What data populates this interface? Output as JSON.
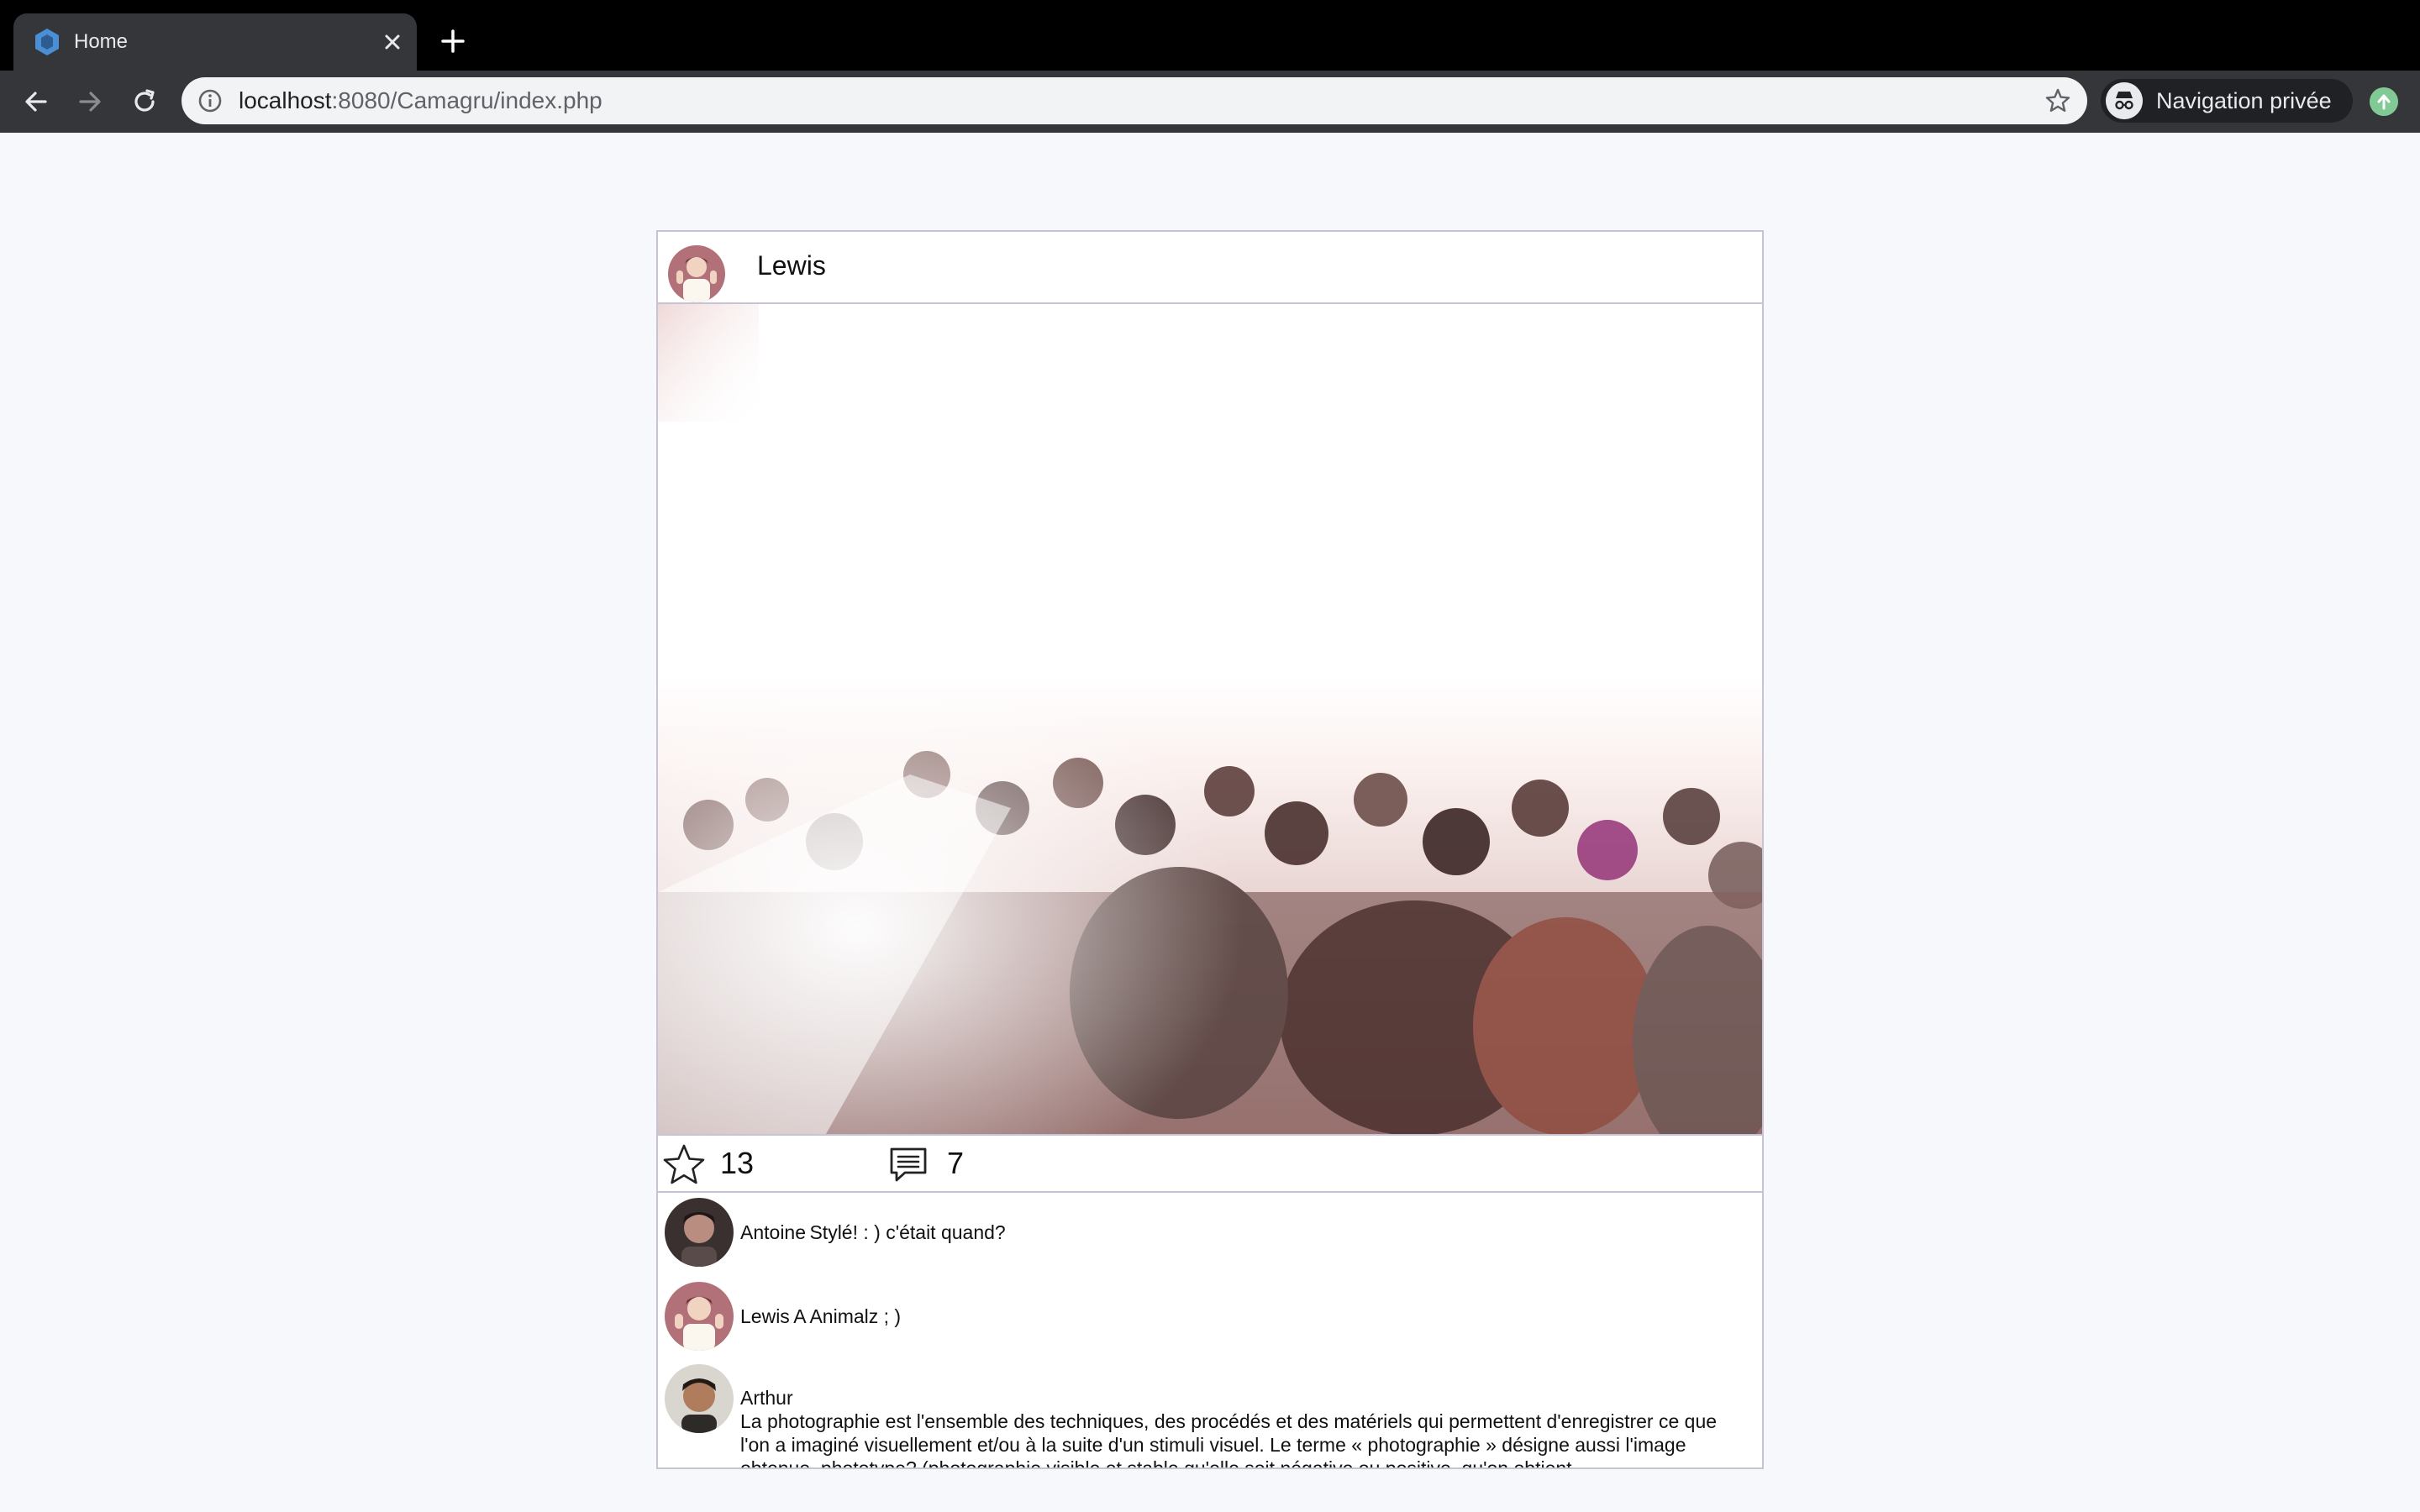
{
  "browser": {
    "tab": {
      "title": "Home"
    },
    "omnibox": {
      "host": "localhost",
      "path": ":8080/Camagru/index.php"
    },
    "incognito_label": "Navigation privée",
    "icons": {
      "favicon": "app-favicon-icon",
      "close": "close-icon",
      "new_tab": "plus-icon",
      "back": "back-arrow-icon",
      "forward": "forward-arrow-icon",
      "reload": "reload-icon",
      "info": "info-icon",
      "bookmark": "star-icon",
      "incognito": "incognito-icon",
      "update": "update-icon"
    }
  },
  "post": {
    "author": {
      "name": "Lewis"
    },
    "likes": "13",
    "comments_count": "7",
    "comments": [
      {
        "author": "Antoine",
        "text": "Stylé! : ) c'était quand?"
      },
      {
        "author": "Lewis",
        "text": "A Animalz ; )"
      },
      {
        "author": "Arthur",
        "text": "La photographie est l'ensemble des techniques, des procédés et des matériels qui permettent d'enregistrer ce que l'on a imaginé visuellement et/ou à la suite d'un stimuli visuel. Le terme « photographie » désigne aussi l'image obtenue, phototype? (photographie visible et stable qu'elle soit négative ou positive, qu'on obtient"
      }
    ]
  },
  "colors": {
    "page_bg": "#f7f8fc",
    "card_border": "#c7c3d4",
    "chrome_dark": "#000000",
    "chrome_toolbar": "#35363a"
  }
}
